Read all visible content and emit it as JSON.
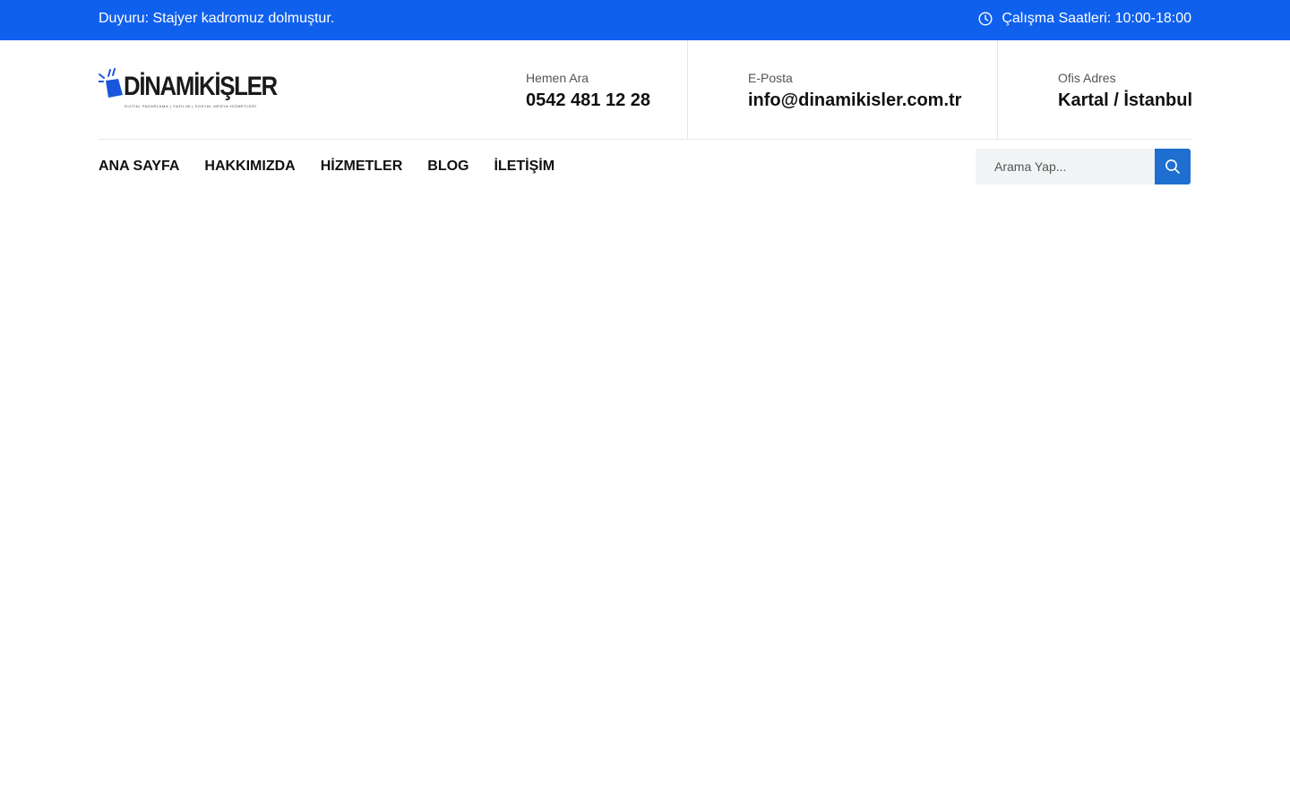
{
  "topbar": {
    "announcement": "Duyuru: Stajyer kadromuz dolmuştur.",
    "hours": "Çalışma Saatleri: 10:00-18:00",
    "hours_icon": "clock-icon",
    "background": "#1060ee"
  },
  "logo": {
    "name": "DİNAMİKİŞLER",
    "tagline": "DİJİTAL PAZARLAMA | YAZILIM | SOSYAL MEDYA HİZMETLERİ",
    "accent": "#1a56db"
  },
  "contacts": [
    {
      "label": "Hemen Ara",
      "value": "0542 481 12 28"
    },
    {
      "label": "E-Posta",
      "value": "info@dinamikisler.com.tr"
    },
    {
      "label": "Ofis Adres",
      "value": "Kartal / İstanbul"
    }
  ],
  "nav": {
    "items": [
      "ANA SAYFA",
      "HAKKIMIZDA",
      "HİZMETLER",
      "BLOG",
      "İLETİŞİM"
    ]
  },
  "search": {
    "placeholder": "Arama Yap...",
    "button_icon": "search-icon",
    "button_color": "#1f6fd0"
  }
}
